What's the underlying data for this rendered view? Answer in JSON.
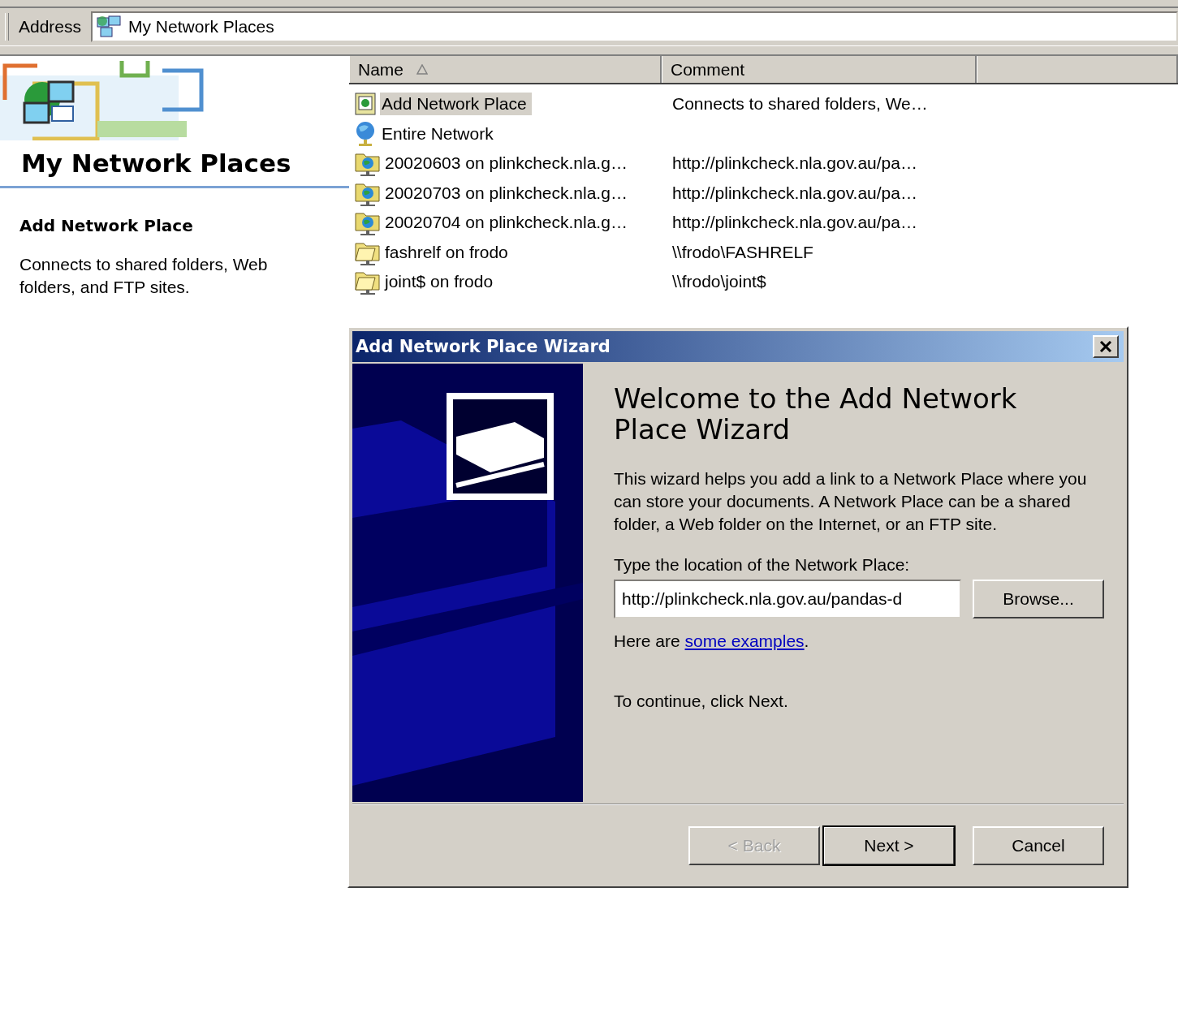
{
  "address_bar": {
    "label": "Address",
    "value": "My Network Places"
  },
  "sidebar": {
    "title": "My Network Places",
    "heading": "Add Network Place",
    "description": "Connects to shared folders, Web folders, and FTP sites."
  },
  "list": {
    "columns": [
      {
        "label": "Name",
        "sorted": true
      },
      {
        "label": "Comment",
        "sorted": false
      }
    ],
    "rows": [
      {
        "kind": "wizard",
        "name": "Add Network Place",
        "comment": "Connects to shared folders, We…",
        "selected": true
      },
      {
        "kind": "globe",
        "name": "Entire Network",
        "selected": false
      },
      {
        "kind": "web-folder",
        "name": "20020603 on plinkcheck.nla.g…",
        "comment": "http://plinkcheck.nla.gov.au/pa…",
        "selected": false
      },
      {
        "kind": "web-folder",
        "name": "20020703 on plinkcheck.nla.g…",
        "comment": "http://plinkcheck.nla.gov.au/pa…",
        "selected": false
      },
      {
        "kind": "web-folder",
        "name": "20020704 on plinkcheck.nla.g…",
        "comment": "http://plinkcheck.nla.gov.au/pa…",
        "selected": false
      },
      {
        "kind": "share",
        "name": "fashrelf on frodo",
        "comment": "\\\\frodo\\FASHRELF",
        "selected": false
      },
      {
        "kind": "share",
        "name": "joint$ on frodo",
        "comment": "\\\\frodo\\joint$",
        "selected": false
      }
    ]
  },
  "wizard": {
    "title": "Add Network Place Wizard",
    "heading": "Welcome to the Add Network Place Wizard",
    "intro": "This wizard helps you add a link to a Network Place where you can store your documents. A Network Place can be a shared folder, a Web folder on the Internet, or an FTP site.",
    "field_label": "Type the location of the Network Place:",
    "location": "http://plinkcheck.nla.gov.au/pandas-d",
    "browse": "Browse...",
    "examples_prefix": "Here are",
    "examples_link": "some examples",
    "examples_suffix": ".",
    "continue_text": "To continue, click Next.",
    "buttons": [
      {
        "label": "< Back",
        "disabled": true,
        "default": false
      },
      {
        "label": "Next >",
        "disabled": false,
        "default": true
      },
      {
        "label": "Cancel",
        "disabled": false,
        "default": false
      }
    ]
  }
}
